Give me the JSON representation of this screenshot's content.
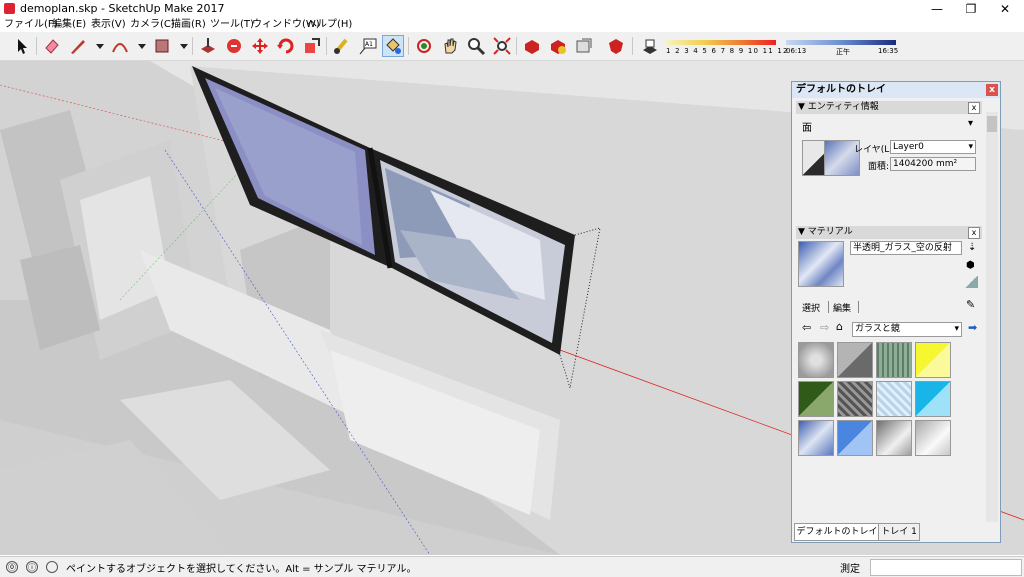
{
  "window": {
    "title": "demoplan.skp - SketchUp Make 2017",
    "minimize": "—",
    "maximize": "❐",
    "close": "✕"
  },
  "menu": [
    "ファイル(F)",
    "編集(E)",
    "表示(V)",
    "カメラ(C)",
    "描画(R)",
    "ツール(T)",
    "ウィンドウ(W)",
    "ヘルプ(H)"
  ],
  "shadow": {
    "month_ticks": [
      "1",
      "2",
      "3",
      "4",
      "5",
      "6",
      "7",
      "8",
      "9",
      "10",
      "11",
      "12"
    ],
    "time_start": "06:13",
    "time_mid": "正午",
    "time_end": "16:35"
  },
  "tray": {
    "title": "デフォルトのトレイ",
    "close": "x",
    "entity_info": {
      "header": "エンティティ情報",
      "type": "面",
      "layer_label": "レイヤ(L):",
      "layer_value": "Layer0",
      "area_label": "面積:",
      "area_value": "1404200 mm²"
    },
    "materials": {
      "header": "マテリアル",
      "material_name": "半透明_ガラス_空の反射",
      "tab_select": "選択",
      "tab_edit": "編集",
      "collection": "ガラスと鏡",
      "swatch_colors": [
        "#b8b8b8",
        "#7a7a7a",
        "#6e8f78",
        "#f3f31c",
        "#3b6a1f",
        "#6b6b6b",
        "#c4dcef",
        "#29c3f0",
        "#5a7cc0",
        "#6a9ff0",
        "#9a9a9a",
        "#c8c8c8"
      ]
    },
    "bottom_tabs": [
      "デフォルトのトレイ",
      "トレイ 1"
    ]
  },
  "status": {
    "message": "ペイントするオブジェクトを選択してください。Alt = サンプル マテリアル。",
    "measure_label": "測定",
    "info_icon": "ⓘ",
    "geo_icon": "⓪"
  }
}
